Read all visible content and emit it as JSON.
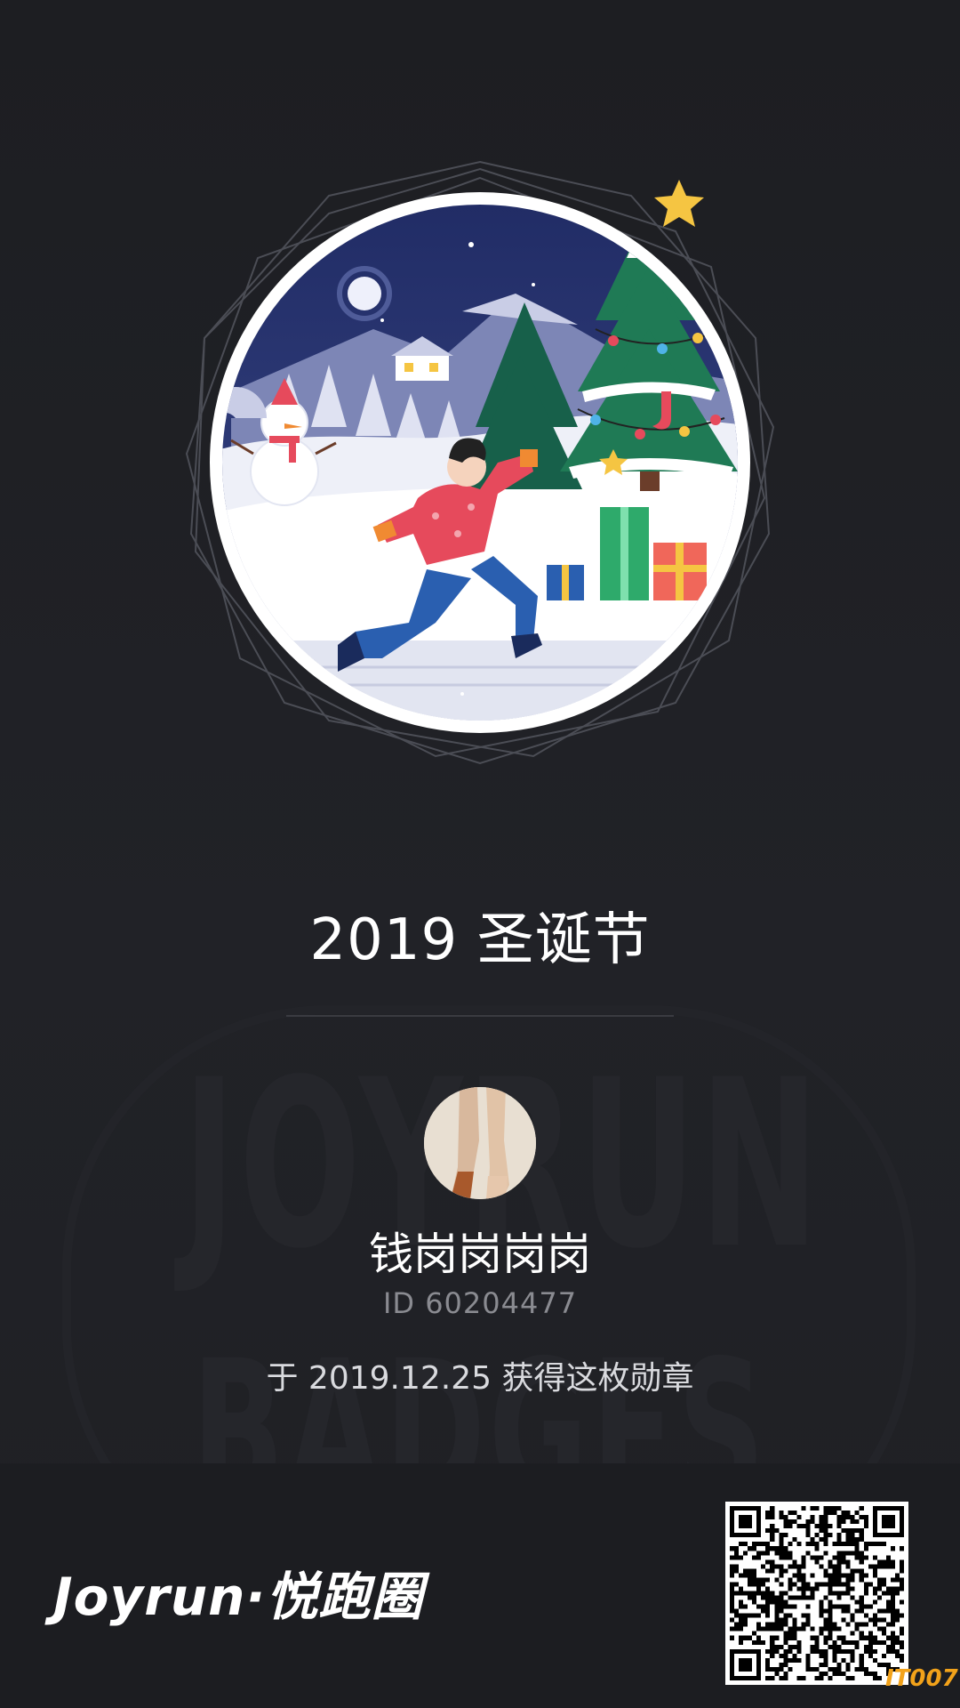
{
  "badge": {
    "title": "2019 圣诞节"
  },
  "user": {
    "name": "钱岗岗岗岗",
    "id_text": "ID 60204477"
  },
  "earned_text": "于 2019.12.25 获得这枚勋章",
  "watermark": {
    "line1": "JOYRUN",
    "line2": "BADGES"
  },
  "brand": {
    "logo_text": "Joyrun·悦跑圈"
  },
  "sitemark": "IT007",
  "colors": {
    "background": "#1e1f23",
    "sky": "#25316b",
    "tree": "#1f7a55",
    "runner_shirt": "#e64a5c",
    "runner_pants": "#2a5fb0",
    "star": "#f5c542"
  },
  "icons": [
    "badge-illustration",
    "avatar",
    "qr-code"
  ]
}
